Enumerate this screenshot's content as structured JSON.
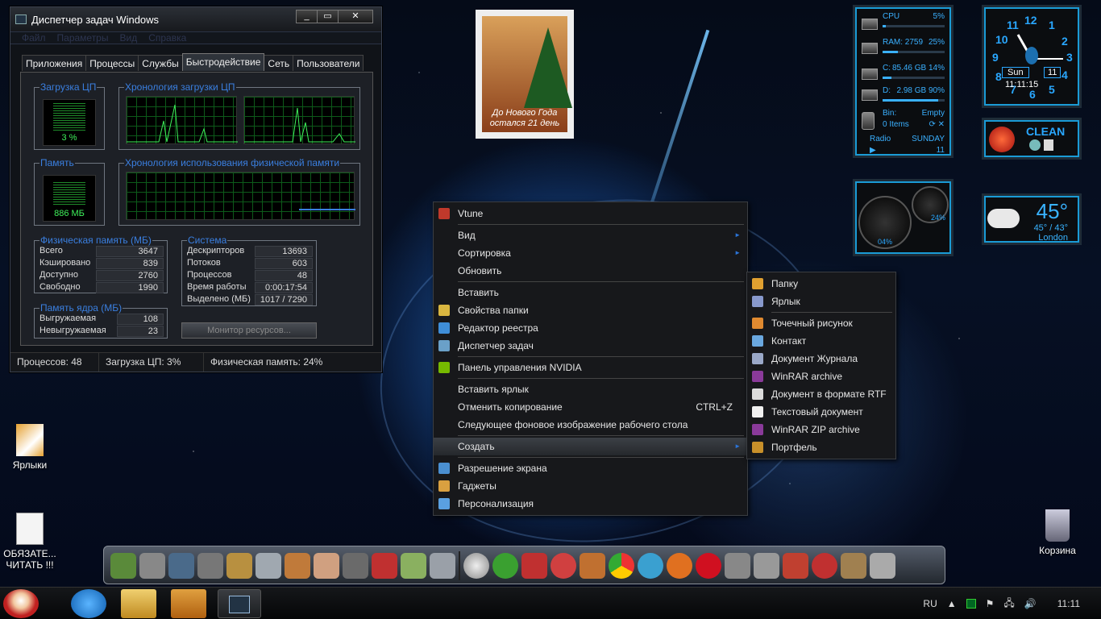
{
  "task_manager": {
    "title": "Диспетчер задач Windows",
    "win_buttons": {
      "minimize": "_",
      "maximize": "▭",
      "close": "✕"
    },
    "menu": [
      "Файл",
      "Параметры",
      "Вид",
      "Справка"
    ],
    "tabs": [
      "Приложения",
      "Процессы",
      "Службы",
      "Быстродействие",
      "Сеть",
      "Пользователи"
    ],
    "active_tab": 3,
    "cpu_label": "Загрузка ЦП",
    "cpu_value": "3 %",
    "cpu_history_label": "Хронология загрузки ЦП",
    "mem_label": "Память",
    "mem_value": "886 МБ",
    "mem_history_label": "Хронология использования физической памяти",
    "phys": {
      "label": "Физическая память (МБ)",
      "rows": [
        {
          "k": "Всего",
          "v": "3647"
        },
        {
          "k": "Кэшировано",
          "v": "839"
        },
        {
          "k": "Доступно",
          "v": "2760"
        },
        {
          "k": "Свободно",
          "v": "1990"
        }
      ]
    },
    "system": {
      "label": "Система",
      "rows": [
        {
          "k": "Дескрипторов",
          "v": "13693"
        },
        {
          "k": "Потоков",
          "v": "603"
        },
        {
          "k": "Процессов",
          "v": "48"
        },
        {
          "k": "Время работы",
          "v": "0:00:17:54"
        },
        {
          "k": "Выделено (МБ)",
          "v": "1017 / 7290"
        }
      ]
    },
    "kernel": {
      "label": "Память ядра (МБ)",
      "rows": [
        {
          "k": "Выгружаемая",
          "v": "108"
        },
        {
          "k": "Невыгружаемая",
          "v": "23"
        }
      ]
    },
    "resource_monitor_label": "Монитор ресурсов...",
    "status": [
      "Процессов: 48",
      "Загрузка ЦП: 3%",
      "Физическая память: 24%"
    ]
  },
  "stamp": {
    "caption_line1": "До Нового Года",
    "caption_line2": "остался 21 день"
  },
  "sys_gadget": {
    "cpu_label": "CPU",
    "cpu_value": "5%",
    "cpu_fraction": 0.05,
    "ram_label": "RAM: 2759",
    "ram_value": "25%",
    "ram_fraction": 0.25,
    "c_label": "C:",
    "c_value": "85.46 GB 14%",
    "c_fraction": 0.14,
    "d_label": "D:",
    "d_value": "2.98 GB 90%",
    "d_fraction": 0.9,
    "bin_label": "Bin:",
    "bin_items": "0 Items",
    "bin_status": "Empty",
    "radio_label": "Radio",
    "day_name": "SUNDAY",
    "day_number": "11"
  },
  "clock_gadget": {
    "day": "Sun",
    "date": "11",
    "time": "11:11:15",
    "numbers": [
      "12",
      "1",
      "2",
      "3",
      "4",
      "5",
      "6",
      "7",
      "8",
      "9",
      "10",
      "11"
    ]
  },
  "clean_gadget": {
    "label": "CLEAN"
  },
  "gauge_gadget": {
    "left_value": "04%",
    "right_value": "24%"
  },
  "weather_gadget": {
    "temp": "45°",
    "range": "45° / 43°",
    "city": "London"
  },
  "desktop_icons": [
    {
      "label": "Ярлыки"
    },
    {
      "label_line1": "ОБЯЗАТЕ...",
      "label_line2": "ЧИТАТЬ !!!"
    },
    {
      "label": "Корзина"
    }
  ],
  "context_menu": {
    "items": [
      {
        "label": "Vtune",
        "icon": "vtune-icon",
        "color": "#c0392b"
      },
      {
        "sep": true
      },
      {
        "label": "Вид",
        "arrow": "►"
      },
      {
        "label": "Сортировка",
        "arrow": "►"
      },
      {
        "label": "Обновить"
      },
      {
        "sep": true
      },
      {
        "label": "Вставить"
      },
      {
        "label": "Свойства папки",
        "icon": "folder-options-icon",
        "color": "#d9b640"
      },
      {
        "label": "Редактор реестра",
        "icon": "registry-icon",
        "color": "#3f8ed8"
      },
      {
        "label": "Диспетчер задач",
        "icon": "task-manager-icon",
        "color": "#6aa0c8"
      },
      {
        "sep": true
      },
      {
        "label": "Панель управления NVIDIA",
        "icon": "nvidia-icon",
        "color": "#76b900"
      },
      {
        "sep": true
      },
      {
        "label": "Вставить ярлык"
      },
      {
        "label": "Отменить копирование",
        "shortcut": "CTRL+Z"
      },
      {
        "label": "Следующее фоновое изображение рабочего стола"
      },
      {
        "sep": true
      },
      {
        "label": "Создать",
        "arrow": "►",
        "active": true
      },
      {
        "sep": true
      },
      {
        "label": "Разрешение экрана",
        "icon": "display-icon",
        "color": "#4a8fd1"
      },
      {
        "label": "Гаджеты",
        "icon": "gadgets-icon",
        "color": "#d9a040"
      },
      {
        "label": "Персонализация",
        "icon": "personalize-icon",
        "color": "#5aa0e0"
      }
    ]
  },
  "submenu": {
    "items": [
      {
        "label": "Папку",
        "icon": "folder-icon",
        "color": "#e0a030"
      },
      {
        "label": "Ярлык",
        "icon": "shortcut-icon",
        "color": "#8899cc"
      },
      {
        "sep": true
      },
      {
        "label": "Точечный рисунок",
        "icon": "bitmap-icon",
        "color": "#e08a30"
      },
      {
        "label": "Контакт",
        "icon": "contact-icon",
        "color": "#6aa8e0"
      },
      {
        "label": "Документ Журнала",
        "icon": "journal-icon",
        "color": "#9aa8c8"
      },
      {
        "label": "WinRAR archive",
        "icon": "winrar-icon",
        "color": "#8a3a9a"
      },
      {
        "label": "Документ в формате RTF",
        "icon": "rtf-icon",
        "color": "#dcdcdc"
      },
      {
        "label": "Текстовый документ",
        "icon": "text-doc-icon",
        "color": "#f0f0f0"
      },
      {
        "label": "WinRAR ZIP archive",
        "icon": "winrar-zip-icon",
        "color": "#8a3a9a"
      },
      {
        "label": "Портфель",
        "icon": "briefcase-icon",
        "color": "#c8902a"
      }
    ]
  },
  "tray": {
    "lang": "RU",
    "time": "11:11"
  },
  "colors": {
    "accent": "#2b74d8",
    "gadget_blue": "#1a9bd6",
    "meter_green": "#3ef05a"
  }
}
